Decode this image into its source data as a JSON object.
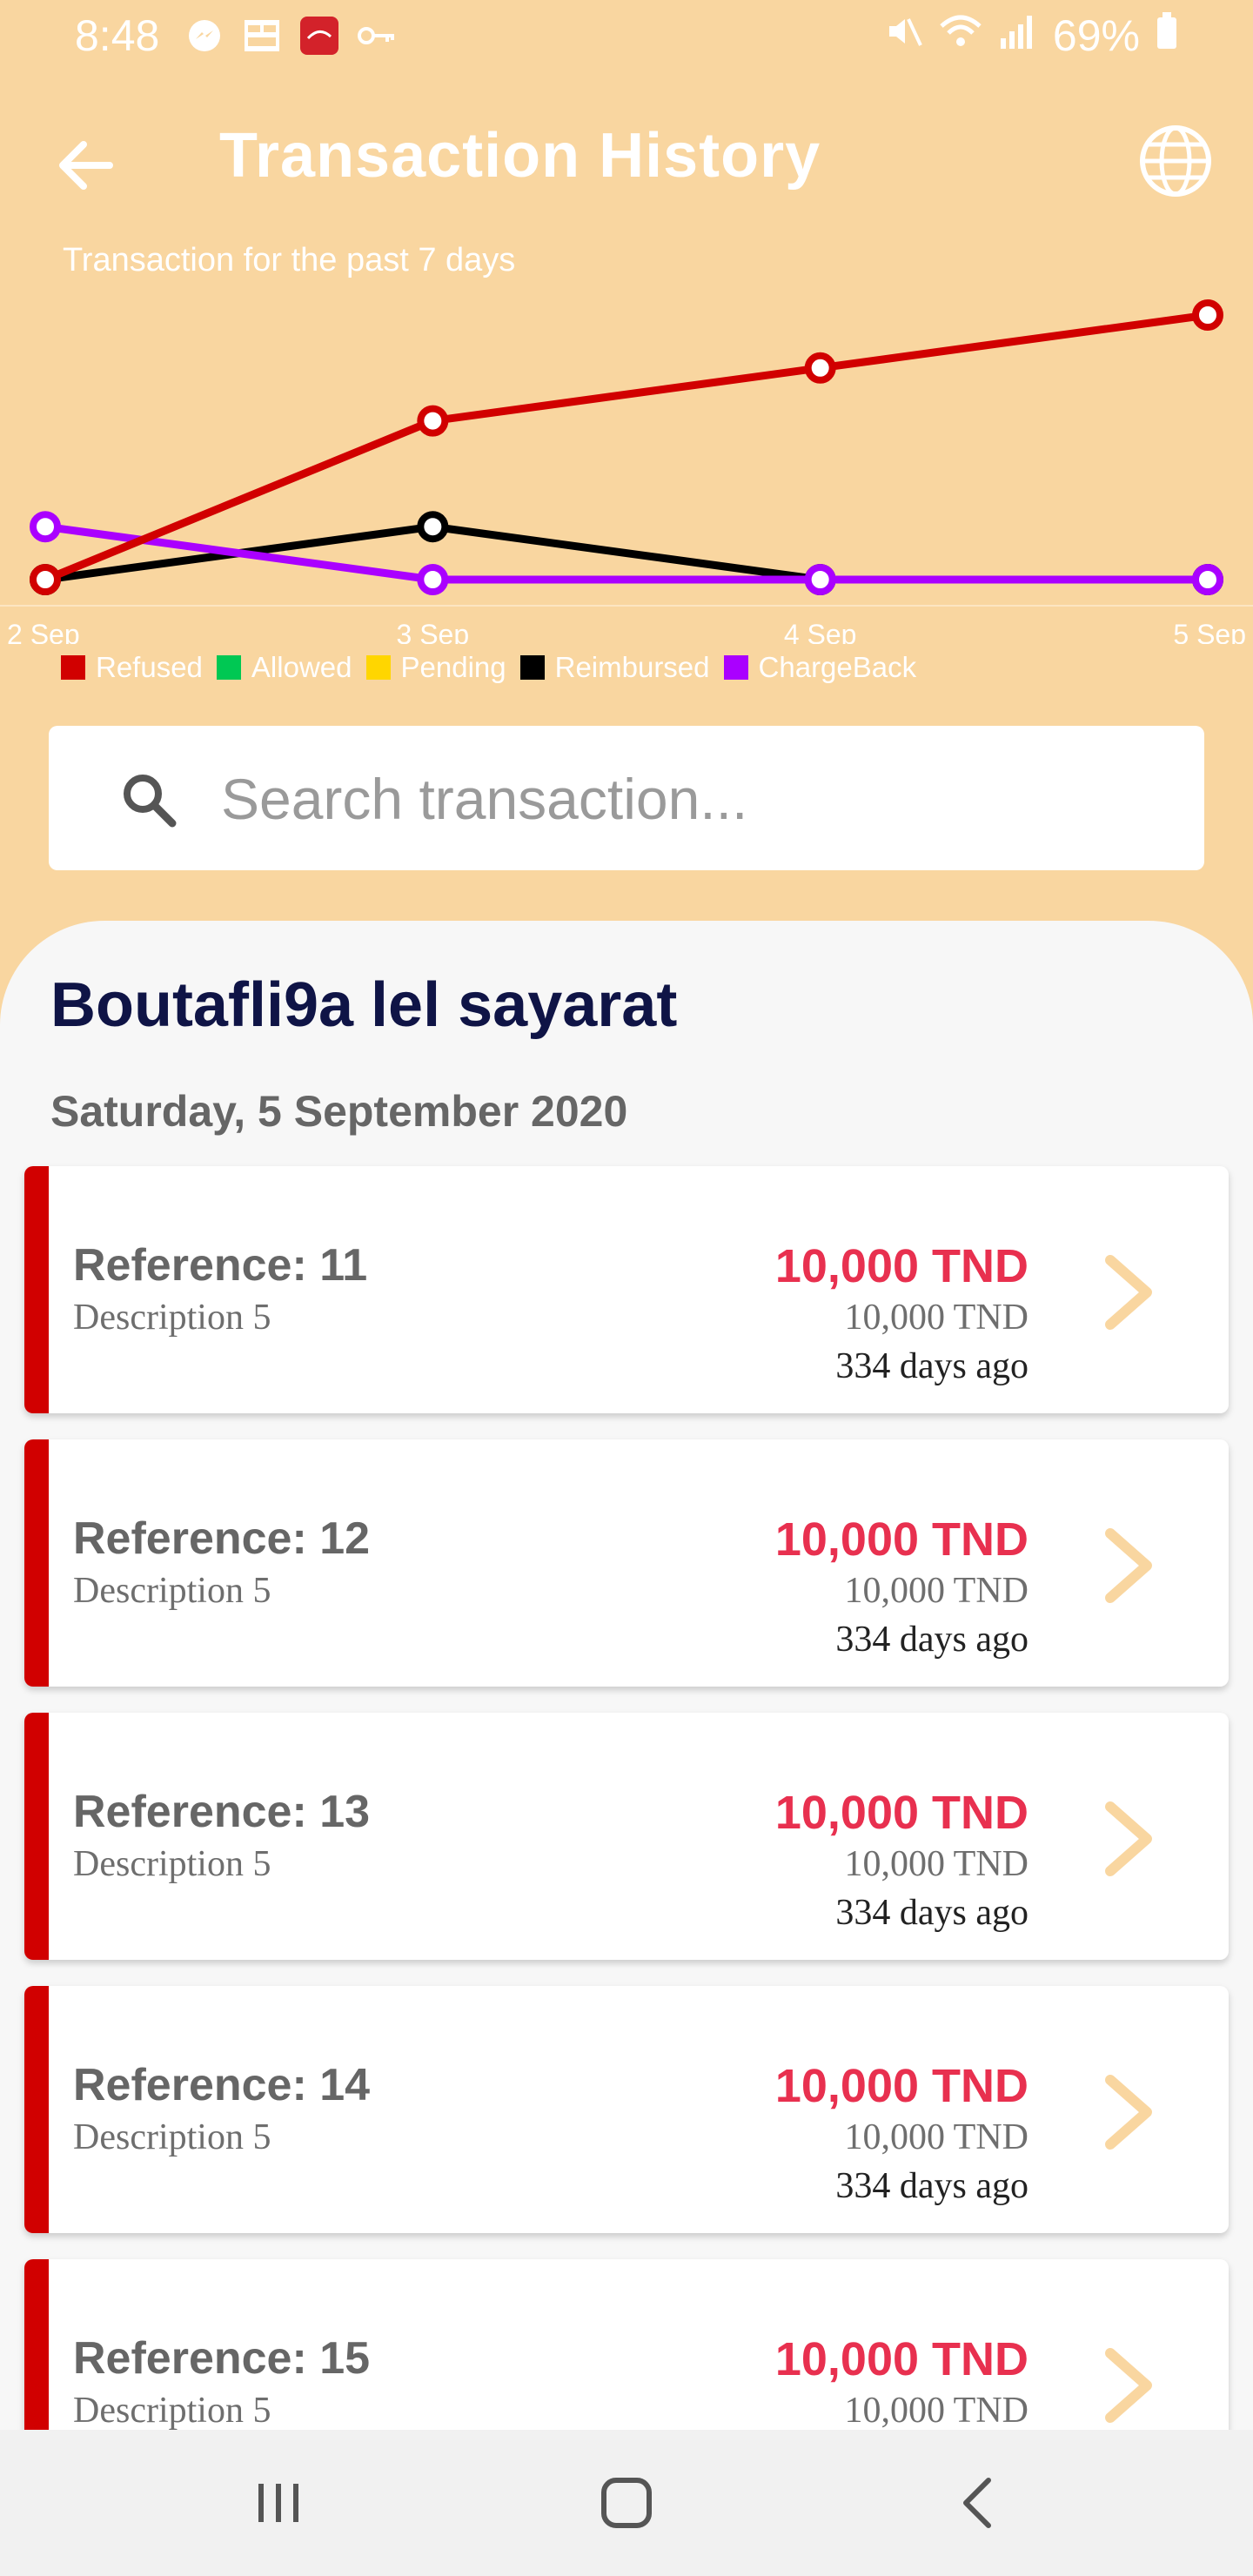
{
  "status_bar": {
    "time": "8:48",
    "battery": "69%",
    "icons": [
      "messenger-icon",
      "grid-app-icon",
      "app-badge-icon",
      "key-icon",
      "mute-icon",
      "wifi-icon",
      "signal-icon",
      "battery-icon"
    ]
  },
  "header": {
    "title": "Transaction History",
    "back_icon": "arrow-left-icon",
    "globe_icon": "globe-icon"
  },
  "chart_data": {
    "type": "line",
    "subtitle": "Transaction for the past 7 days",
    "categories": [
      "2 Sep",
      "3 Sep",
      "4 Sep",
      "5 Sep"
    ],
    "ylim": [
      0,
      5
    ],
    "grid": false,
    "series": [
      {
        "name": "Refused",
        "color": "#d10000",
        "values": [
          0,
          3,
          4,
          5
        ]
      },
      {
        "name": "Allowed",
        "color": "#00c853",
        "values": []
      },
      {
        "name": "Pending",
        "color": "#ffd600",
        "values": []
      },
      {
        "name": "Reimbursed",
        "color": "#000000",
        "values": [
          0,
          1,
          0,
          0
        ]
      },
      {
        "name": "ChargeBack",
        "color": "#aa00ff",
        "values": [
          1,
          0,
          0,
          0
        ]
      }
    ]
  },
  "search": {
    "placeholder": "Search transaction..."
  },
  "merchant": {
    "name": "Boutafli9a lel sayarat"
  },
  "date_heading": "Saturday, 5 September 2020",
  "transactions": [
    {
      "reference": "Reference: 11",
      "description": "Description 5",
      "amount": "10,000 TND",
      "amount_secondary": "10,000 TND",
      "time_ago": "334 days ago"
    },
    {
      "reference": "Reference: 12",
      "description": "Description 5",
      "amount": "10,000 TND",
      "amount_secondary": "10,000 TND",
      "time_ago": "334 days ago"
    },
    {
      "reference": "Reference: 13",
      "description": "Description 5",
      "amount": "10,000 TND",
      "amount_secondary": "10,000 TND",
      "time_ago": "334 days ago"
    },
    {
      "reference": "Reference: 14",
      "description": "Description 5",
      "amount": "10,000 TND",
      "amount_secondary": "10,000 TND",
      "time_ago": "334 days ago"
    },
    {
      "reference": "Reference: 15",
      "description": "Description 5",
      "amount": "10,000 TND",
      "amount_secondary": "10,000 TND",
      "time_ago": ""
    }
  ],
  "nav_bar": {
    "recents_icon": "recent-apps-icon",
    "home_icon": "home-icon",
    "back_icon": "nav-back-icon"
  },
  "colors": {
    "background": "#f9d6a0",
    "accent_red": "#d10000",
    "amount_pink": "#e8304f",
    "merchant_navy": "#0f1446",
    "arrow_peach": "#f9d6a0"
  }
}
